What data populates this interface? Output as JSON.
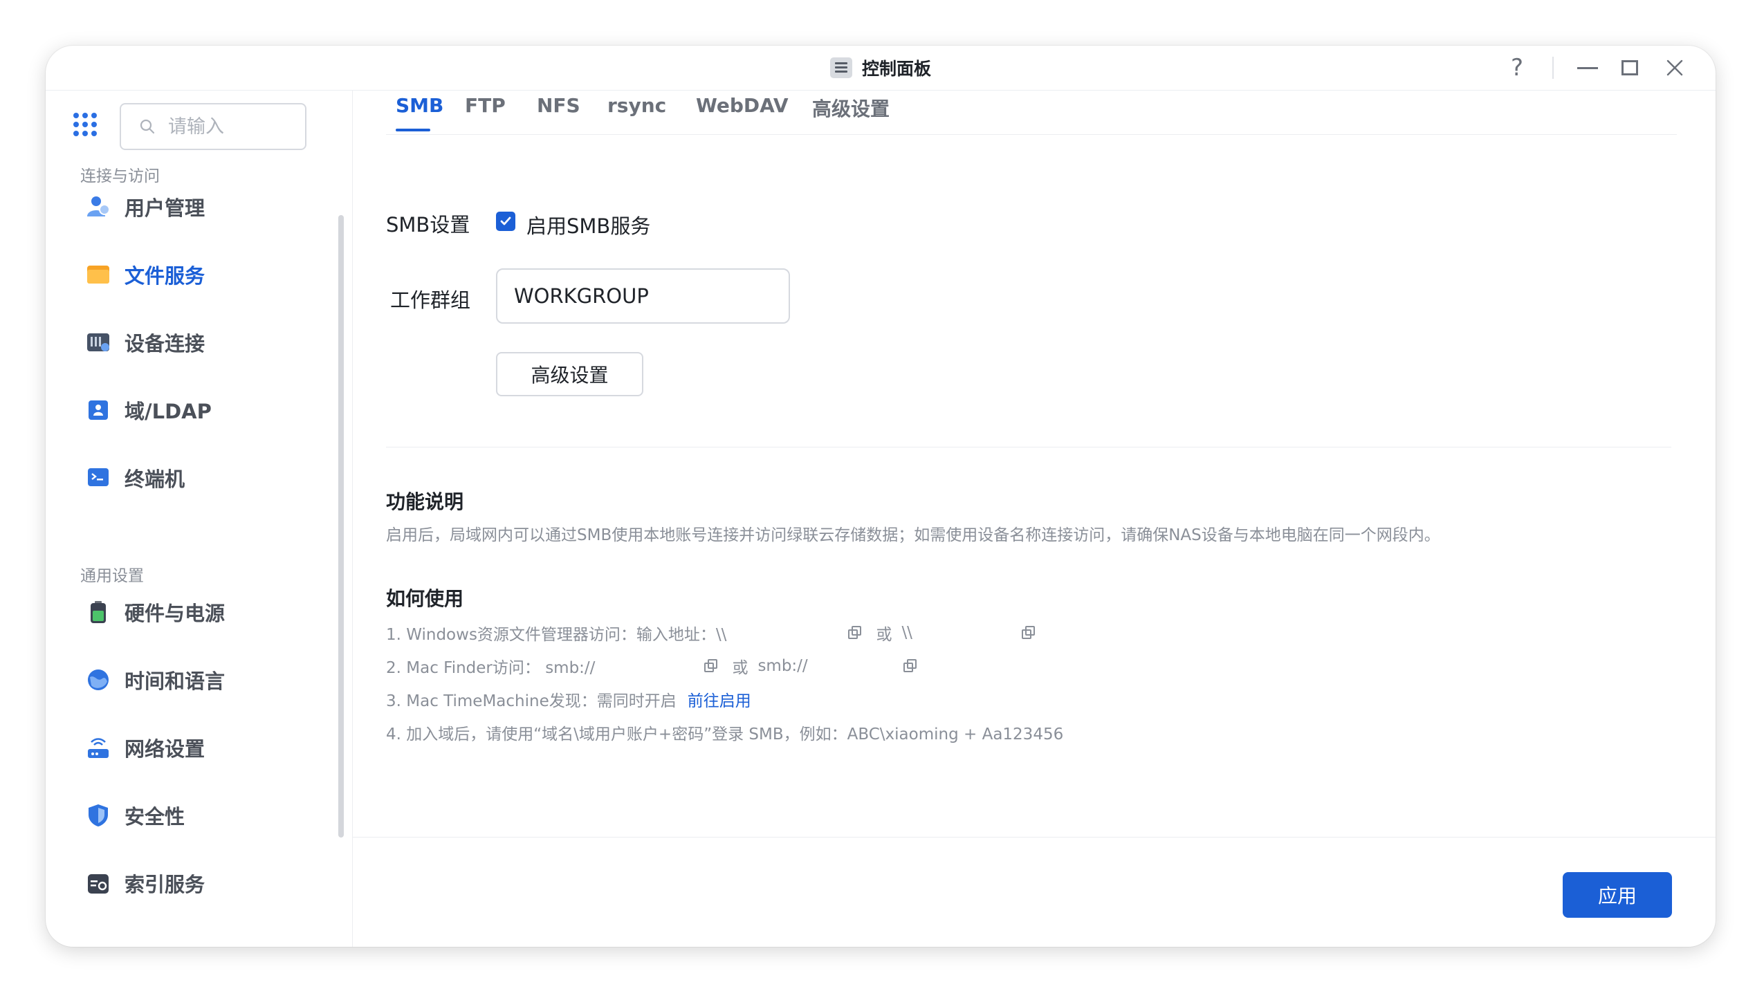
{
  "window": {
    "title": "控制面板",
    "help_label": "?"
  },
  "search": {
    "placeholder": "请输入"
  },
  "sidebar": {
    "groups": [
      {
        "label": "连接与访问"
      },
      {
        "label": "通用设置"
      }
    ],
    "items": [
      {
        "label": "用户管理",
        "icon": "users-icon"
      },
      {
        "label": "文件服务",
        "icon": "folder-icon",
        "active": true
      },
      {
        "label": "设备连接",
        "icon": "device-icon"
      },
      {
        "label": "域/LDAP",
        "icon": "ldap-icon"
      },
      {
        "label": "终端机",
        "icon": "terminal-icon"
      },
      {
        "label": "硬件与电源",
        "icon": "battery-icon"
      },
      {
        "label": "时间和语言",
        "icon": "globe-icon"
      },
      {
        "label": "网络设置",
        "icon": "router-icon"
      },
      {
        "label": "安全性",
        "icon": "shield-icon"
      },
      {
        "label": "索引服务",
        "icon": "index-icon"
      }
    ]
  },
  "tabs": [
    {
      "label": "SMB",
      "active": true
    },
    {
      "label": "FTP"
    },
    {
      "label": "NFS"
    },
    {
      "label": "rsync"
    },
    {
      "label": "WebDAV"
    },
    {
      "label": "高级设置"
    }
  ],
  "smb": {
    "settings_label": "SMB设置",
    "enable_label": "启用SMB服务",
    "enabled": true,
    "workgroup_label": "工作群组",
    "workgroup_value": "WORKGROUP",
    "advanced_button": "高级设置"
  },
  "description": {
    "title": "功能说明",
    "text": "启用后，局域网内可以通过SMB使用本地账号连接并访问绿联云存储数据；如需使用设备名称连接访问，请确保NAS设备与本地电脑在同一个网段内。"
  },
  "usage": {
    "title": "如何使用",
    "step1_prefix": "1. Windows资源文件管理器访问：输入地址：\\\\",
    "step1_or": "或",
    "step1_alt": "\\\\",
    "step2_prefix": "2. Mac Finder访问：  smb://",
    "step2_or": "或",
    "step2_alt": "smb://",
    "step3_prefix": "3. Mac TimeMachine发现：需同时开启",
    "step3_link": "前往启用",
    "step4": "4. 加入域后，请使用“域名\\域用户账户+密码”登录 SMB，例如：ABC\\xiaoming + Aa123456"
  },
  "footer": {
    "apply_label": "应用"
  },
  "colors": {
    "accent": "#1b5fd6",
    "muted_text": "#8a8f98"
  }
}
